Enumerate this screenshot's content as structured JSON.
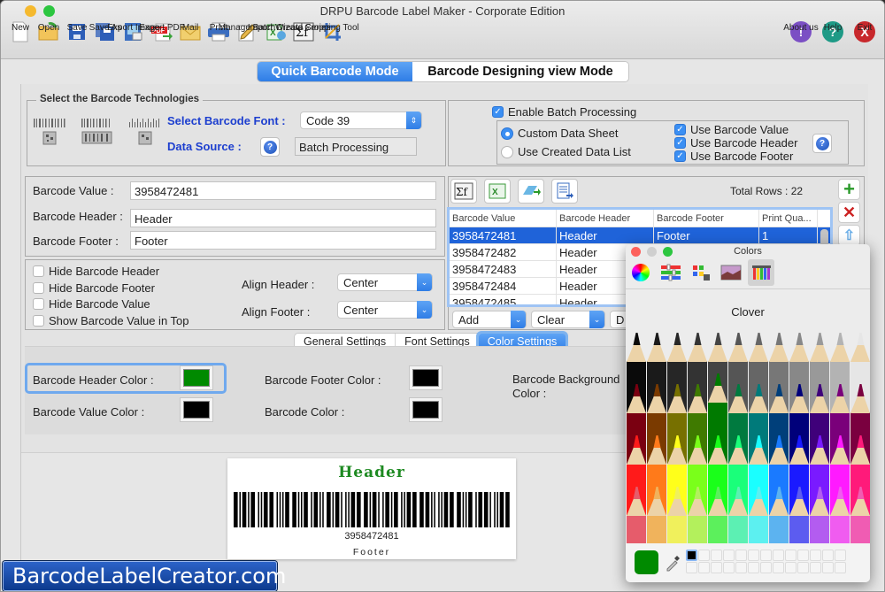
{
  "window": {
    "title": "DRPU Barcode Label Maker - Corporate Edition"
  },
  "toolbar": {
    "items": [
      {
        "id": "new",
        "label": "New",
        "icon": "new-document-icon"
      },
      {
        "id": "open",
        "label": "Open",
        "icon": "open-folder-icon"
      },
      {
        "id": "save",
        "label": "Save",
        "icon": "floppy-save-icon"
      },
      {
        "id": "save-as",
        "label": "Save As",
        "icon": "save-as-icon"
      },
      {
        "id": "export-image",
        "label": "Export Image",
        "icon": "export-image-icon"
      },
      {
        "id": "export-pdf",
        "label": "Export PDF",
        "icon": "pdf-icon"
      },
      {
        "id": "mail",
        "label": "Mail",
        "icon": "mail-icon"
      },
      {
        "id": "print",
        "label": "Print",
        "icon": "printer-icon"
      },
      {
        "id": "manage-batch",
        "label": "Manage Batch",
        "icon": "edit-pencil-icon"
      },
      {
        "id": "import-wizard",
        "label": "Import Wizard",
        "icon": "excel-import-icon"
      },
      {
        "id": "create-series",
        "label": "Create Series",
        "icon": "sigma-fx-icon"
      },
      {
        "id": "cropping-tool",
        "label": "Cropping Tool",
        "icon": "crop-icon"
      }
    ],
    "right": [
      {
        "id": "about",
        "label": "About us",
        "icon": "info-exclamation-icon",
        "glyph": "!",
        "color": "#7b4fc4"
      },
      {
        "id": "help",
        "label": "Help",
        "icon": "help-question-icon",
        "glyph": "?",
        "color": "#1e9a86"
      },
      {
        "id": "exit",
        "label": "Exit",
        "icon": "exit-x-icon",
        "glyph": "X",
        "color": "#c8282c"
      }
    ]
  },
  "modes": {
    "quick": "Quick Barcode Mode",
    "designing": "Barcode Designing view Mode"
  },
  "technologies": {
    "group_title": "Select the Barcode Technologies",
    "font_label": "Select Barcode Font :",
    "font_value": "Code 39",
    "source_label": "Data Source :",
    "source_value": "Batch Processing"
  },
  "batch": {
    "enable_label": "Enable Batch Processing",
    "enable_checked": true,
    "custom_sheet": "Custom Data Sheet",
    "created_list": "Use Created Data List",
    "selected_source": "custom",
    "use_value": "Use Barcode Value",
    "use_header": "Use Barcode Header",
    "use_footer": "Use Barcode Footer"
  },
  "fields": {
    "value_label": "Barcode Value :",
    "value": "3958472481",
    "header_label": "Barcode Header :",
    "header": "Header",
    "footer_label": "Barcode Footer :",
    "footer": "Footer"
  },
  "options": {
    "hide_header": "Hide Barcode Header",
    "hide_footer": "Hide Barcode Footer",
    "hide_value": "Hide Barcode Value",
    "show_value_top": "Show Barcode Value in Top",
    "align_header_label": "Align Header :",
    "align_header": "Center",
    "align_footer_label": "Align Footer :",
    "align_footer": "Center"
  },
  "grid": {
    "total_rows_label": "Total Rows : 22",
    "columns": [
      "Barcode Value",
      "Barcode Header",
      "Barcode Footer",
      "Print Qua..."
    ],
    "rows": [
      [
        "3958472481",
        "Header",
        "Footer",
        "1"
      ],
      [
        "3958472482",
        "Header",
        "",
        ""
      ],
      [
        "3958472483",
        "Header",
        "",
        ""
      ],
      [
        "3958472484",
        "Header",
        "",
        ""
      ],
      [
        "3958472485",
        "Header",
        "",
        ""
      ]
    ],
    "add_label": "Add",
    "clear_label": "Clear",
    "third_label": "D"
  },
  "settings_tabs": {
    "general": "General Settings",
    "font": "Font Settings",
    "color": "Color Settings"
  },
  "colors_section": {
    "header_color_label": "Barcode Header Color :",
    "header_color": "#008a00",
    "footer_color_label": "Barcode Footer Color :",
    "footer_color": "#000000",
    "background_color_label": "Barcode Background Color :",
    "value_color_label": "Barcode Value Color :",
    "value_color": "#000000",
    "barcode_color_label": "Barcode Color :",
    "barcode_color": "#000000"
  },
  "preview": {
    "header": "Header",
    "value": "3958472481",
    "footer": "Footer",
    "header_color": "#1e8a22"
  },
  "colors_panel": {
    "title": "Colors",
    "selected_name": "Clover",
    "current_color": "#008a00",
    "tabs": [
      "color-wheel-icon",
      "sliders-icon",
      "palettes-icon",
      "image-palette-icon",
      "crayons-icon"
    ]
  },
  "brand": {
    "text": "BarcodeLabelCreator.com"
  }
}
